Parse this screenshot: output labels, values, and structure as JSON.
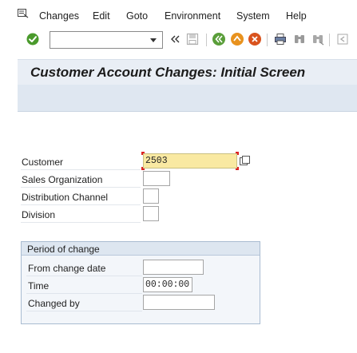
{
  "menu": {
    "items": [
      "Changes",
      "Edit",
      "Goto",
      "Environment",
      "System",
      "Help"
    ]
  },
  "toolbar": {
    "command_field_value": "",
    "icons": [
      "enter-icon",
      "double-left-icon",
      "save-icon",
      "back-icon",
      "exit-icon",
      "cancel-icon",
      "print-icon",
      "find-icon",
      "find-next-icon",
      "first-page-icon"
    ]
  },
  "page": {
    "title": "Customer Account Changes: Initial Screen"
  },
  "form": {
    "customer_label": "Customer",
    "customer_value": "2503",
    "sales_org_label": "Sales Organization",
    "sales_org_value": "",
    "dist_channel_label": "Distribution Channel",
    "dist_channel_value": "",
    "division_label": "Division",
    "division_value": ""
  },
  "period": {
    "title": "Period of change",
    "from_date_label": "From change date",
    "from_date_value": "",
    "time_label": "Time",
    "time_value": "00:00:00",
    "changed_by_label": "Changed by",
    "changed_by_value": ""
  },
  "colors": {
    "title_band": "#e9eef5",
    "app_bar": "#dfe7f1",
    "required_field": "#f9e9a2",
    "group_header": "#dde6f0",
    "enter_green": "#4a9a2c",
    "back_green": "#5a9e3a",
    "exit_orange": "#e8921e",
    "cancel_red": "#d9531e"
  }
}
